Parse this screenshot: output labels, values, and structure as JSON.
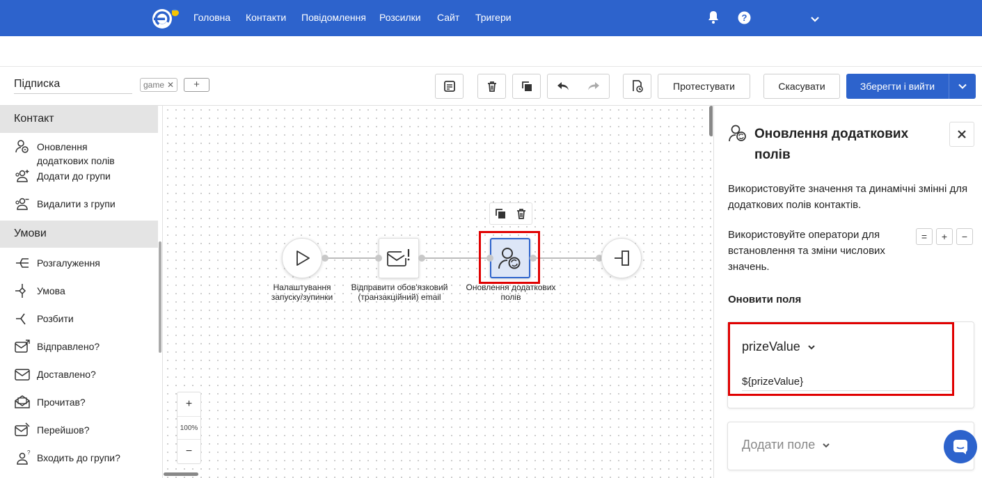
{
  "nav": {
    "links": [
      "Головна",
      "Контакти",
      "Повідомлення",
      "Розсилки",
      "Сайт",
      "Тригери"
    ]
  },
  "toolbar": {
    "flow_name": "Підписка",
    "tag": "game",
    "tag_add": "+",
    "test_label": "Протестувати",
    "cancel_label": "Скасувати",
    "save_label": "Зберегти і вийти"
  },
  "sidebar": {
    "section_contact": "Контакт",
    "contact_items": [
      "Оновлення додаткових полів",
      "Додати до групи",
      "Видалити з групи"
    ],
    "section_conditions": "Умови",
    "condition_items": [
      "Розгалуження",
      "Умова",
      "Розбити",
      "Відправлено?",
      "Доставлено?",
      "Прочитав?",
      "Перейшов?",
      "Входить до групи?"
    ]
  },
  "canvas": {
    "nodes": [
      "Налаштування запуску/зупинки",
      "Відправити обов'язковий (транзакційний) email",
      "Оновлення додаткових полів"
    ],
    "zoom_in": "+",
    "zoom_level": "100%",
    "zoom_out": "−"
  },
  "panel": {
    "title": "Оновлення додаткових полів",
    "description": "Використовуйте значення та динамічні змінні для додаткових полів контактів.",
    "operators_text": "Використовуйте оператори для встановлення та зміни числових значень.",
    "operators": [
      "=",
      "+",
      "−"
    ],
    "update_fields_label": "Оновити поля",
    "field_name": "prizeValue",
    "field_value": "${prizeValue}",
    "add_field_label": "Додати поле"
  },
  "colors": {
    "brand": "#2d63cc",
    "highlight": "#e00000"
  }
}
